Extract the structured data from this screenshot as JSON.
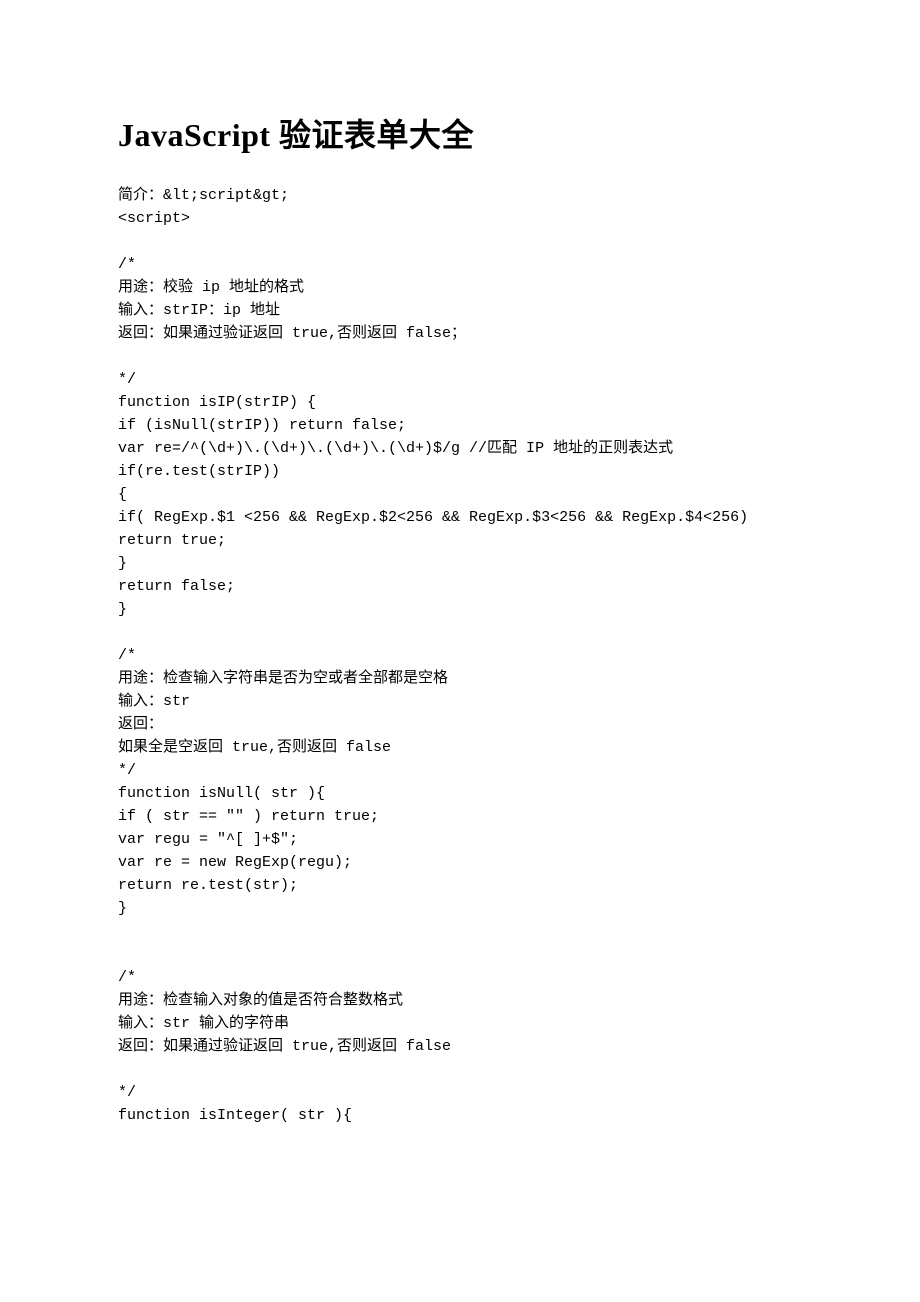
{
  "title": "JavaScript 验证表单大全",
  "lines": [
    "简介：&lt;script&gt;",
    "<script>",
    "",
    "/*",
    "用途：校验 ip 地址的格式",
    "输入：strIP：ip 地址",
    "返回：如果通过验证返回 true,否则返回 false；",
    "",
    "*/",
    "function isIP(strIP) {",
    "if (isNull(strIP)) return false;",
    "var re=/^(\\d+)\\.(\\d+)\\.(\\d+)\\.(\\d+)$/g //匹配 IP 地址的正则表达式",
    "if(re.test(strIP))",
    "{",
    "if( RegExp.$1 <256 && RegExp.$2<256 && RegExp.$3<256 && RegExp.$4<256)",
    "return true;",
    "}",
    "return false;",
    "}",
    "",
    "/*",
    "用途：检查输入字符串是否为空或者全部都是空格",
    "输入：str",
    "返回：",
    "如果全是空返回 true,否则返回 false",
    "*/",
    "function isNull( str ){",
    "if ( str == \"\" ) return true;",
    "var regu = \"^[ ]+$\";",
    "var re = new RegExp(regu);",
    "return re.test(str);",
    "}",
    "",
    "",
    "/*",
    "用途：检查输入对象的值是否符合整数格式",
    "输入：str 输入的字符串",
    "返回：如果通过验证返回 true,否则返回 false",
    "",
    "*/",
    "function isInteger( str ){"
  ]
}
